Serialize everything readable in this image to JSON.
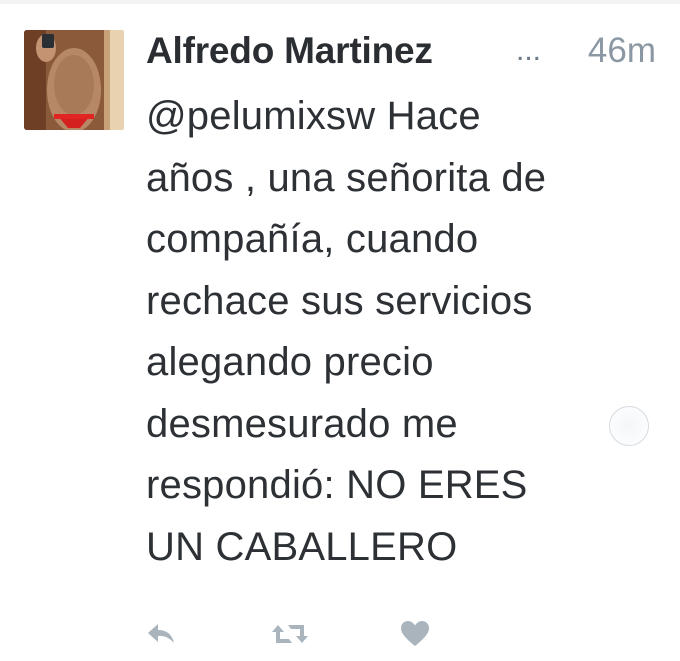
{
  "tweet": {
    "author_name": "Alfredo Martinez",
    "name_truncation": "...",
    "timestamp": "46m",
    "text": "@pelumixsw Hace\naños , una señorita de\ncompañía, cuando\nrechace sus servicios\nalegando precio\ndesmesurado me\nrespondió: NO ERES\nUN CABALLERO",
    "avatar_icon": "profile-photo",
    "actions": [
      {
        "name": "reply",
        "icon": "reply-arrow-icon"
      },
      {
        "name": "retweet",
        "icon": "retweet-icon"
      },
      {
        "name": "like",
        "icon": "heart-icon"
      }
    ]
  },
  "colors": {
    "name": "#2a2d31",
    "text": "#2d3135",
    "meta": "#8b98a4",
    "action_icons": "#aab4bd"
  }
}
